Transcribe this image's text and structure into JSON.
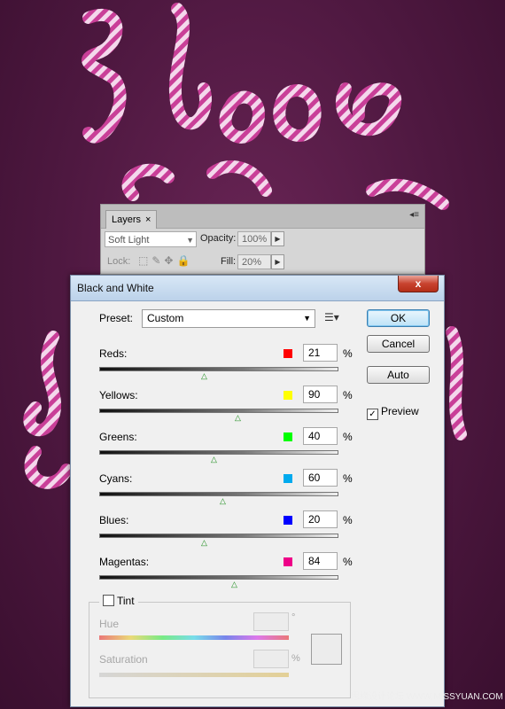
{
  "layers_panel": {
    "tab_label": "Layers",
    "tab_close": "×",
    "panel_menu": "◂≡",
    "blend_mode": "Soft Light",
    "opacity_label": "Opacity:",
    "opacity_value": "100%",
    "lock_label": "Lock:",
    "fill_label": "Fill:",
    "fill_value": "20%"
  },
  "dialog": {
    "title": "Black and White",
    "close_glyph": "x",
    "preset_label": "Preset:",
    "preset_value": "Custom",
    "buttons": {
      "ok": "OK",
      "cancel": "Cancel",
      "auto": "Auto"
    },
    "preview_label": "Preview",
    "preview_checked": true,
    "percent_sign": "%",
    "sliders": [
      {
        "label": "Reds:",
        "value": "21",
        "color": "#ff0000"
      },
      {
        "label": "Yellows:",
        "value": "90",
        "color": "#ffff00"
      },
      {
        "label": "Greens:",
        "value": "40",
        "color": "#00ff00"
      },
      {
        "label": "Cyans:",
        "value": "60",
        "color": "#00aaee"
      },
      {
        "label": "Blues:",
        "value": "20",
        "color": "#0000ff"
      },
      {
        "label": "Magentas:",
        "value": "84",
        "color": "#ee0088"
      }
    ],
    "tint": {
      "label": "Tint",
      "checked": false,
      "hue_label": "Hue",
      "degree_sign": "°",
      "saturation_label": "Saturation"
    }
  },
  "watermark": "思缘设计论坛 WWW.MISSYUAN.COM"
}
